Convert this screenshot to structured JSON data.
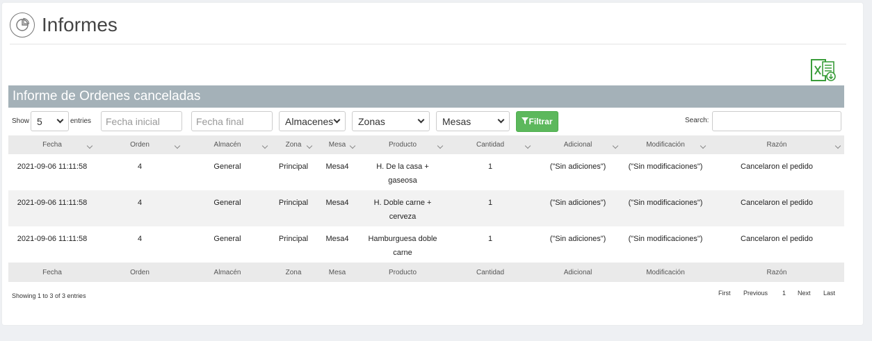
{
  "page": {
    "title": "Informes",
    "title_icon": "pie-chart-icon",
    "export_icon": "excel-export-icon"
  },
  "report": {
    "title": "Informe de Ordenes canceladas"
  },
  "controls": {
    "show_label": "Show",
    "entries_label": "entries",
    "page_length": "5",
    "fecha_inicial_placeholder": "Fecha inicial",
    "fecha_final_placeholder": "Fecha final",
    "almacenes": "Almacenes",
    "zonas": "Zonas",
    "mesas": "Mesas",
    "filter_label": "Filtrar",
    "filter_icon": "filter-icon",
    "search_label": "Search:",
    "filter_color": "#5cb85c"
  },
  "table": {
    "columns": [
      "Fecha",
      "Orden",
      "Almacén",
      "Zona",
      "Mesa",
      "Producto",
      "Cantidad",
      "Adicional",
      "Modificación",
      "Razón"
    ],
    "rows": [
      [
        "2021-09-06 11:11:58",
        "4",
        "General",
        "Principal",
        "Mesa4",
        "H. De la casa + gaseosa",
        "1",
        "(\"Sin adiciones\")",
        "(\"Sin modificaciones\")",
        "Cancelaron el pedido"
      ],
      [
        "2021-09-06 11:11:58",
        "4",
        "General",
        "Principal",
        "Mesa4",
        "H. Doble carne + cerveza",
        "1",
        "(\"Sin adiciones\")",
        "(\"Sin modificaciones\")",
        "Cancelaron el pedido"
      ],
      [
        "2021-09-06 11:11:58",
        "4",
        "General",
        "Principal",
        "Mesa4",
        "Hamburguesa doble carne",
        "1",
        "(\"Sin adiciones\")",
        "(\"Sin modificaciones\")",
        "Cancelaron el pedido"
      ]
    ]
  },
  "footer": {
    "info": "Showing 1 to 3 of 3 entries",
    "pager": {
      "first": "First",
      "previous": "Previous",
      "current": "1",
      "next": "Next",
      "last": "Last"
    }
  }
}
